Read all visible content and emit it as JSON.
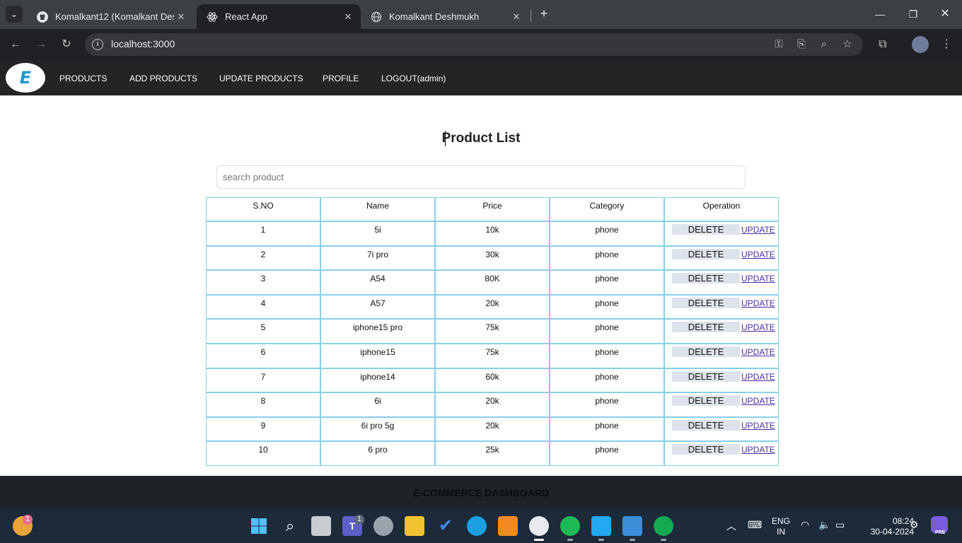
{
  "browser": {
    "tabs": [
      {
        "title": "Komalkant12 (Komalkant Deshmukh)",
        "active": false,
        "icon": "github-icon"
      },
      {
        "title": "React App",
        "active": true,
        "icon": "react-icon"
      },
      {
        "title": "Komalkant Deshmukh",
        "active": false,
        "icon": "globe-icon"
      }
    ],
    "url": "localhost:3000"
  },
  "navbar": {
    "logo_text": "E",
    "links": [
      "PRODUCTS",
      "ADD PRODUCTS",
      "UPDATE PRODUCTS",
      "PROFILE",
      "LOGOUT(admin)"
    ]
  },
  "main": {
    "title": "Product List",
    "search_placeholder": "search product",
    "columns": [
      "S.NO",
      "Name",
      "Price",
      "Category",
      "Operation"
    ],
    "delete_label": "DELETE",
    "update_label": "UPDATE",
    "rows": [
      {
        "sno": "1",
        "name": "5i",
        "price": "10k",
        "category": "phone"
      },
      {
        "sno": "2",
        "name": "7i pro",
        "price": "30k",
        "category": "phone"
      },
      {
        "sno": "3",
        "name": "A54",
        "price": "80K",
        "category": "phone"
      },
      {
        "sno": "4",
        "name": "A57",
        "price": "20k",
        "category": "phone"
      },
      {
        "sno": "5",
        "name": "iphone15 pro",
        "price": "75k",
        "category": "phone"
      },
      {
        "sno": "6",
        "name": "iphone15",
        "price": "75k",
        "category": "phone"
      },
      {
        "sno": "7",
        "name": "iphone14",
        "price": "60k",
        "category": "phone"
      },
      {
        "sno": "8",
        "name": "6i",
        "price": "20k",
        "category": "phone"
      },
      {
        "sno": "9",
        "name": "6i pro 5g",
        "price": "20k",
        "category": "phone"
      },
      {
        "sno": "10",
        "name": "6 pro",
        "price": "25k",
        "category": "phone"
      }
    ]
  },
  "footer": {
    "text": "E-COMMERCE DASHBOARD"
  },
  "taskbar": {
    "language": "ENG",
    "region": "IN",
    "time": "08:24",
    "date": "30-04-2024",
    "weather_badge": "1",
    "teams_badge": "1",
    "copilot_label": "PRE"
  },
  "colors": {
    "nav_bg": "#242424",
    "table_border": "#87ceeb",
    "footer_bg": "#1e2327"
  }
}
